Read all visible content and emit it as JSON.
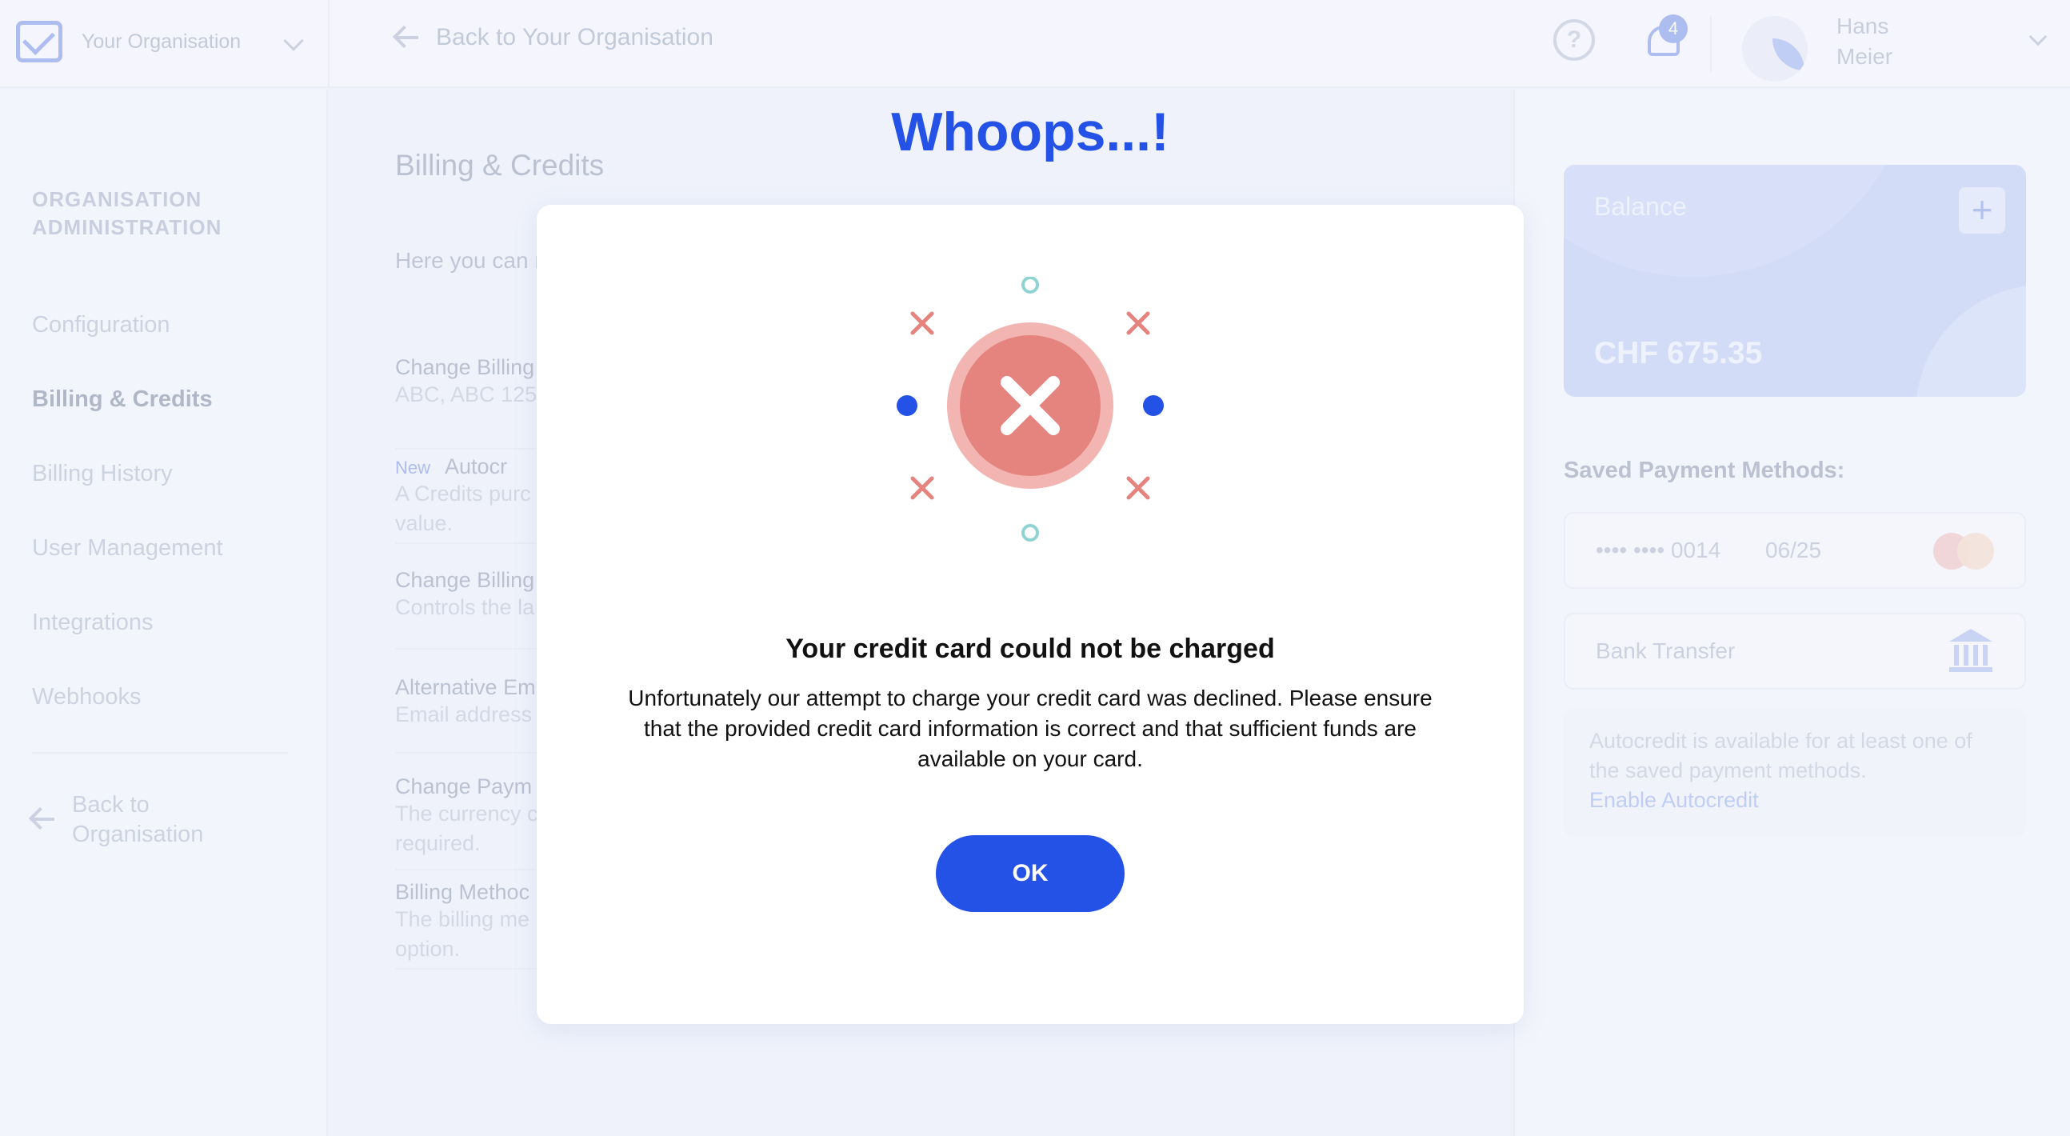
{
  "topbar": {
    "org_name": "Your Organisation",
    "back_label": "Back to Your Organisation",
    "help_icon": "question-icon",
    "notifications_count": "4",
    "user_name": "Hans Meier"
  },
  "sidebar": {
    "heading": "ORGANISATION ADMINISTRATION",
    "items": [
      {
        "label": "Configuration"
      },
      {
        "label": "Billing & Credits"
      },
      {
        "label": "Billing History"
      },
      {
        "label": "User Management"
      },
      {
        "label": "Integrations"
      },
      {
        "label": "Webhooks"
      }
    ],
    "active_item": "Billing & Credits",
    "back_label": "Back to Organisation"
  },
  "main": {
    "title": "Billing & Credits",
    "intro": "Here you can r",
    "settings": [
      {
        "title": "Change Billing",
        "desc": "ABC, ABC 125"
      },
      {
        "badge": "New",
        "title": "Autocr",
        "desc": "A Credits purc value."
      },
      {
        "title": "Change Billing",
        "desc": "Controls the la"
      },
      {
        "title": "Alternative Em",
        "desc": "Email address"
      },
      {
        "title": "Change Paym",
        "desc": "The currency c required."
      },
      {
        "title": "Billing Methoc",
        "desc": "The billing me option."
      }
    ]
  },
  "right_panel": {
    "balance_label": "Balance",
    "balance_value": "CHF 675.35",
    "saved_title": "Saved Payment Methods:",
    "card_number": "•••• •••• 0014",
    "card_expiry": "06/25",
    "card_brand_icon": "mastercard-icon",
    "bank_label": "Bank Transfer",
    "bank_icon": "bank-icon",
    "autocredit_text": "Autocredit is available for at least one of the saved payment methods.",
    "autocredit_link": "Enable Autocredit"
  },
  "modal": {
    "heading": "Whoops...!",
    "icon": "error-x-icon",
    "title": "Your credit card could not be charged",
    "message": "Unfortunately our attempt to charge your credit card was declined. Please ensure that the provided credit card information is correct and that sufficient funds are available on your card.",
    "ok_label": "OK"
  },
  "colors": {
    "primary": "#2451e6",
    "error": "#e5837e",
    "error_ring": "#f2b5b1",
    "accent_teal": "#8fd3d3",
    "background": "#eef1fa"
  }
}
